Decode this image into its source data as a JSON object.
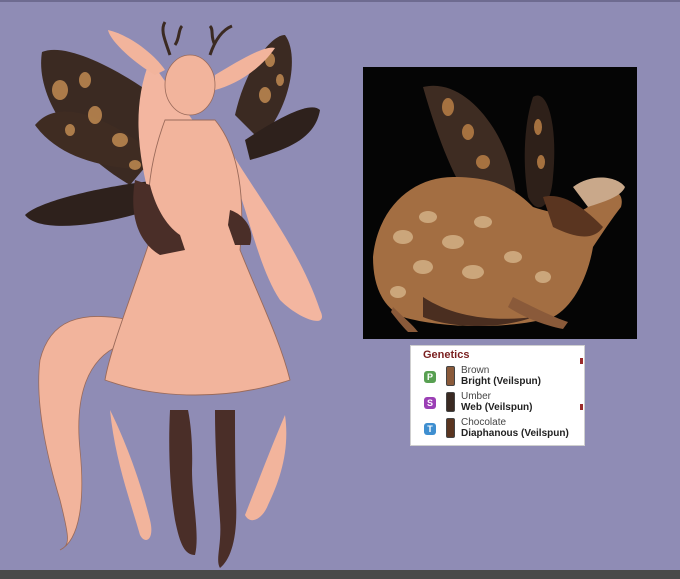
{
  "genetics": {
    "title": "Genetics",
    "genes": [
      {
        "slot": "P",
        "color": "Brown",
        "trait": "Bright (Veilspun)",
        "swatch": "#8a5a3a",
        "gem": "#58a052"
      },
      {
        "slot": "S",
        "color": "Umber",
        "trait": "Web (Veilspun)",
        "swatch": "#3a2a22",
        "gem": "#9b3fb5"
      },
      {
        "slot": "T",
        "color": "Chocolate",
        "trait": "Diaphanous (Veilspun)",
        "swatch": "#5a3520",
        "gem": "#3f8fd0"
      }
    ]
  },
  "colors": {
    "background": "#8f8cb5",
    "skin": "#f2b49c",
    "wing_dark": "#3a2a22",
    "wing_spot": "#c08a52",
    "panel_title": "#7a1f1f"
  }
}
